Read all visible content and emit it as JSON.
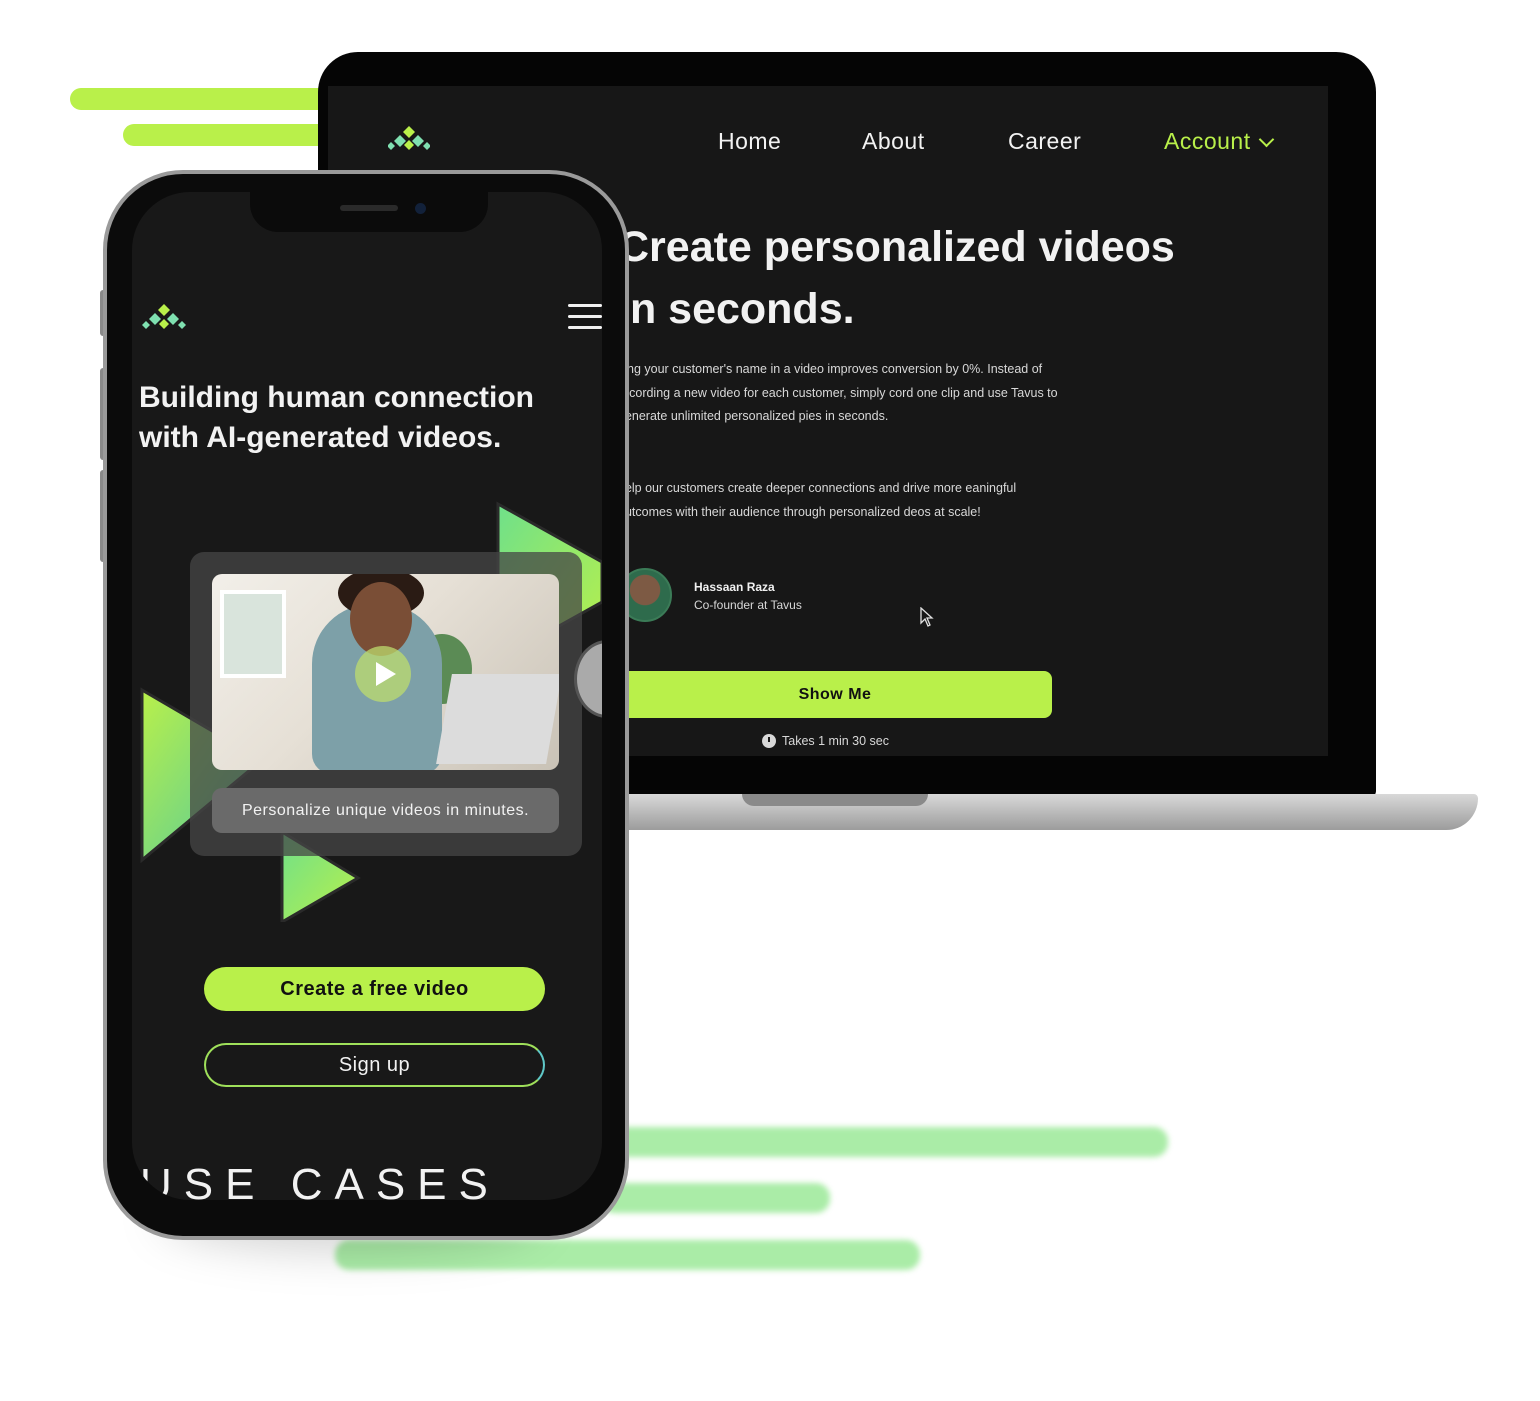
{
  "colors": {
    "accent": "#b9f04a",
    "screen_bg": "#171717",
    "text": "#f2f2f2"
  },
  "desktop": {
    "logo_icon": "tavus-diamond-logo",
    "nav": {
      "home": "Home",
      "about": "About",
      "career": "Career",
      "account": "Account"
    },
    "hero_title": "Create personalized videos in seconds.",
    "paragraph_1": "ying your customer's name in a video improves conversion by 0%. Instead of recording a new video for each customer, simply cord one clip and use Tavus to generate unlimited personalized pies in seconds.",
    "paragraph_2": "help our customers create deeper connections and drive more eaningful outcomes with their audience through personalized deos at scale!",
    "testimonial": {
      "name": "Hassaan Raza",
      "role": "Co-founder at Tavus"
    },
    "cta_label": "Show Me",
    "time_note": "Takes 1 min 30 sec"
  },
  "mobile": {
    "logo_icon": "tavus-diamond-logo",
    "menu_icon": "hamburger-menu-icon",
    "hero_title": "Building human connection with AI-generated videos.",
    "video_caption": "Personalize unique videos in minutes.",
    "primary_cta": "Create a free video",
    "secondary_cta": "Sign up",
    "section_heading": "USE CASES"
  }
}
